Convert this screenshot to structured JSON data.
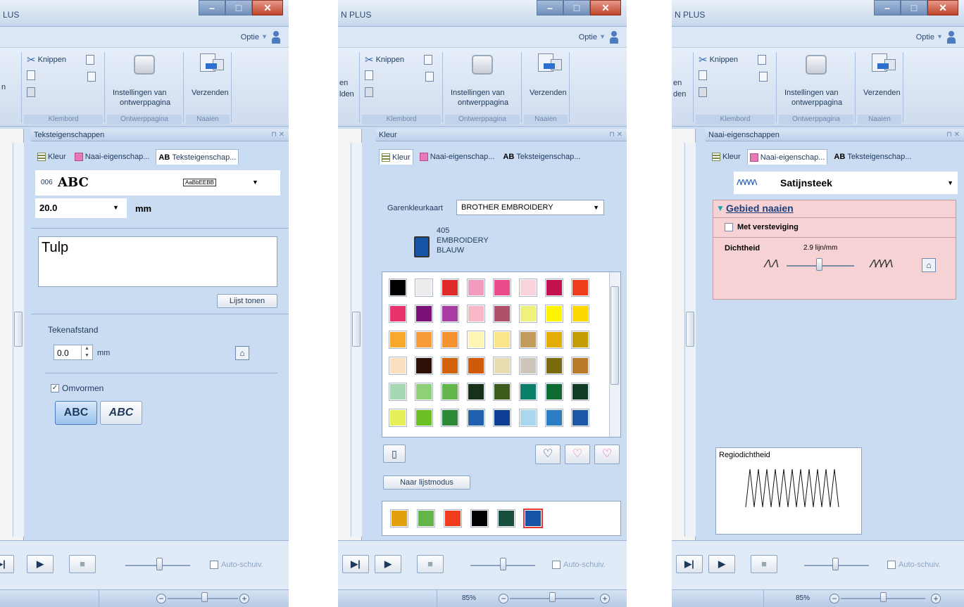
{
  "ribbon": {
    "cut": "Knippen",
    "pageSettings1": "Instellingen van",
    "pageSettings2": "ontwerppagina",
    "send": "Verzenden",
    "groupClipboard": "Klembord",
    "groupPage": "Ontwerppagina",
    "groupSew": "Naaien",
    "optie": "Optie"
  },
  "tabs": {
    "kleur": "Kleur",
    "naai": "Naai-eigenschap...",
    "naaiShort": "Naai-eigenschap...",
    "tekst": "Teksteigenschap..."
  },
  "panel1": {
    "title": "N PLUS",
    "titleVisible": "LUS",
    "ribbonClip": "n",
    "dockTitle": "Teksteigenschappen",
    "fontCode": "006",
    "fontSample": "ABC",
    "fontPreview": "AaBbEEBB",
    "size": "20.0",
    "unitMm": "mm",
    "textValue": "Tulp",
    "listButton": "Lijst tonen",
    "spacingLabel": "Tekenafstand",
    "spacingValue": "0.0",
    "spacingUnit": "mm",
    "transformLabel": "Omvormen",
    "transformChecked": "✓",
    "abc1": "ABC",
    "abc2": "ABC",
    "autoScroll": "Auto-schuiv."
  },
  "panel2": {
    "title": "N PLUS",
    "ribbonClip1": "en",
    "ribbonClip2": "lden",
    "dockTitle": "Kleur",
    "chartLabel": "Garenkleurkaart",
    "chartValue": "BROTHER EMBROIDERY",
    "colorCode": "405",
    "colorBrand": "EMBROIDERY",
    "colorName": "BLAUW",
    "listModeButton": "Naar lijstmodus",
    "zoom": "85%",
    "autoScroll": "Auto-schuiv.",
    "palette": [
      "#000000",
      "#ececec",
      "#e02a2a",
      "#f29bbf",
      "#ec4b8a",
      "#f8d3dc",
      "#c4104e",
      "#f03c1a",
      "#e8336c",
      "#7a1179",
      "#a83ba4",
      "#f7b7c7",
      "#b05069",
      "#eef27c",
      "#fff500",
      "#ffd700",
      "#f7a92c",
      "#f79b39",
      "#f59331",
      "#fdf6b5",
      "#fbe48a",
      "#c39c5c",
      "#e4ad05",
      "#c49c05",
      "#fbdfc1",
      "#2d1006",
      "#d1620a",
      "#d05a0a",
      "#e8dcb0",
      "#cdc4ba",
      "#7b6b0e",
      "#b97b2a",
      "#a5d8b3",
      "#8fcf78",
      "#62b64b",
      "#16301a",
      "#3b5b1d",
      "#0b7f6a",
      "#0d6b31",
      "#0f3d26",
      "#e5ef5a",
      "#6ac024",
      "#2d8a37",
      "#1e5fae",
      "#0c3f93",
      "#a8d7ee",
      "#2b7dc3",
      "#1d57a8"
    ],
    "recent": [
      "#e4a00b",
      "#63b54a",
      "#f03c1a",
      "#000000",
      "#184e3c",
      "#1654a7"
    ]
  },
  "panel3": {
    "title": "N PLUS",
    "ribbonClip1": "en",
    "ribbonClip2": "den",
    "dockTitle": "Naai-eigenschappen",
    "stitchType": "Satijnsteek",
    "section": "Gebied naaien",
    "reinforce": "Met versteviging",
    "densityLabel": "Dichtheid",
    "densityValue": "2.9 lijn/mm",
    "regionLabel": "Regiodichtheid",
    "zoom": "85%",
    "autoScroll": "Auto-schuiv."
  }
}
